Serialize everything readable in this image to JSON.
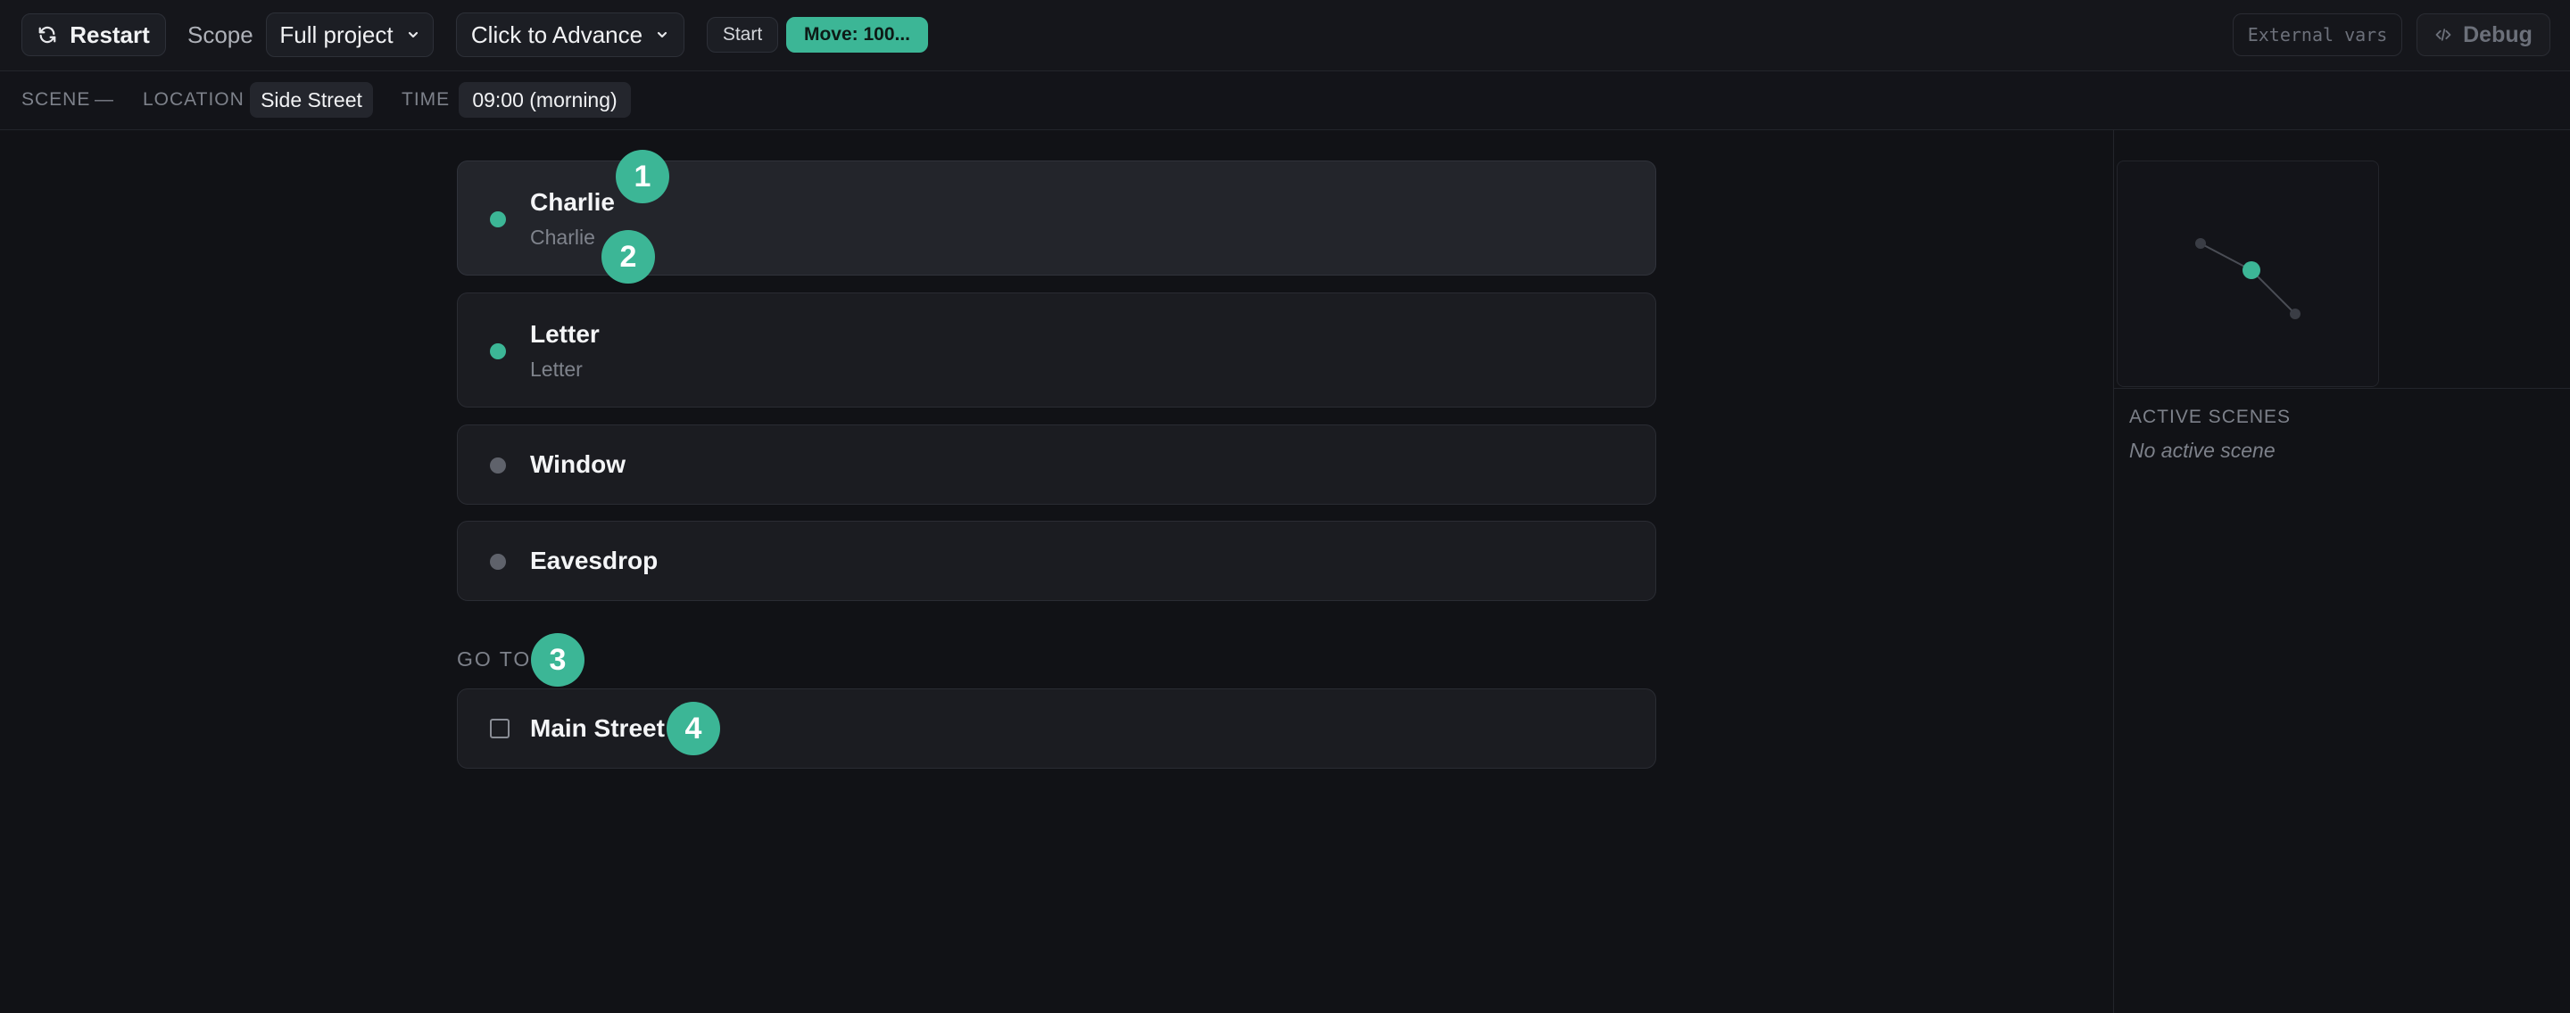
{
  "toolbar": {
    "restart_label": "Restart",
    "scope_label": "Scope",
    "scope_value": "Full project",
    "advance_value": "Click to Advance",
    "start_label": "Start",
    "move_label": "Move: 100...",
    "external_vars_label": "External vars",
    "debug_label": "Debug"
  },
  "statusbar": {
    "scene_label": "SCENE",
    "scene_value": "—",
    "location_label": "LOCATION",
    "location_value": "Side Street",
    "time_label": "TIME",
    "time_value": "09:00 (morning)"
  },
  "choices": [
    {
      "title": "Charlie",
      "subtitle": "Charlie",
      "status": "available"
    },
    {
      "title": "Letter",
      "subtitle": "Letter",
      "status": "available"
    },
    {
      "title": "Window",
      "status": "unavailable"
    },
    {
      "title": "Eavesdrop",
      "status": "unavailable"
    }
  ],
  "goto": {
    "label": "GO TO",
    "items": [
      {
        "title": "Main Street"
      }
    ]
  },
  "badges": [
    "1",
    "2",
    "3",
    "4"
  ],
  "sidebar": {
    "active_scenes_heading": "ACTIVE SCENES",
    "active_scenes_empty": "No active scene"
  },
  "colors": {
    "accent": "#3cb696",
    "background": "#111216",
    "card": "#1b1c21"
  }
}
